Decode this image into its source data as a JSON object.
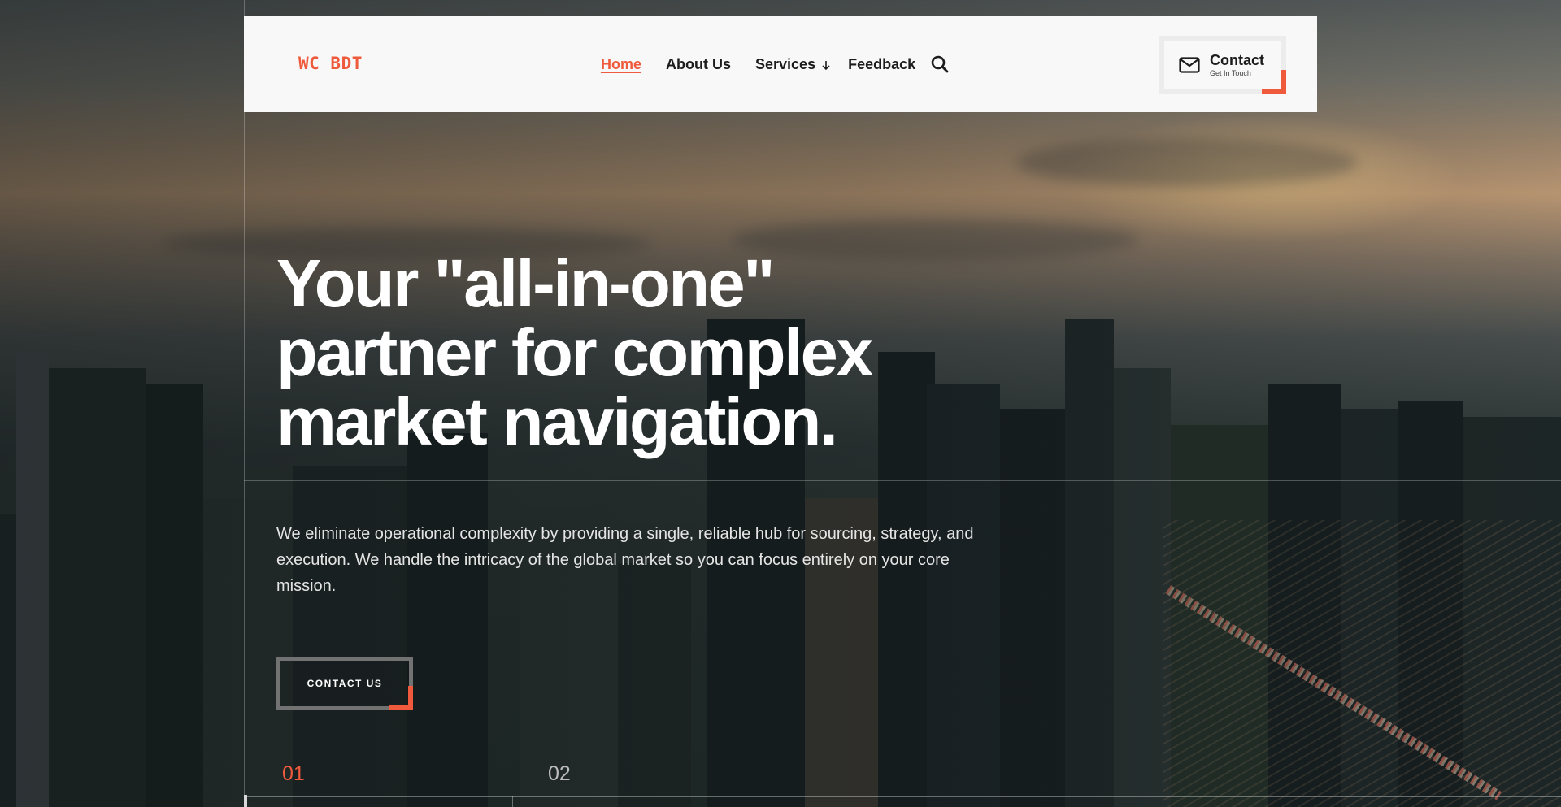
{
  "brand": {
    "logo_text": "WC BDT",
    "accent_color": "#ee5a3b"
  },
  "nav": {
    "items": [
      {
        "label": "Home",
        "active": true
      },
      {
        "label": "About Us",
        "active": false
      },
      {
        "label": "Services",
        "active": false,
        "has_dropdown": true
      },
      {
        "label": "Feedback",
        "active": false
      }
    ],
    "search_icon": "search-icon"
  },
  "contact": {
    "title": "Contact",
    "subtitle": "Get In Touch",
    "icon": "mail-icon"
  },
  "hero": {
    "title_line1": "Your \"all-in-one\"",
    "title_line2": "partner for complex",
    "title_line3": "market navigation.",
    "description": "We eliminate operational complexity by providing a single, reliable hub for sourcing, strategy, and execution. We handle the intricacy of the global market so you can focus entirely on your core mission.",
    "cta_label": "CONTACT US"
  },
  "slider": {
    "slides": [
      {
        "label": "01",
        "active": true
      },
      {
        "label": "02",
        "active": false
      }
    ]
  }
}
